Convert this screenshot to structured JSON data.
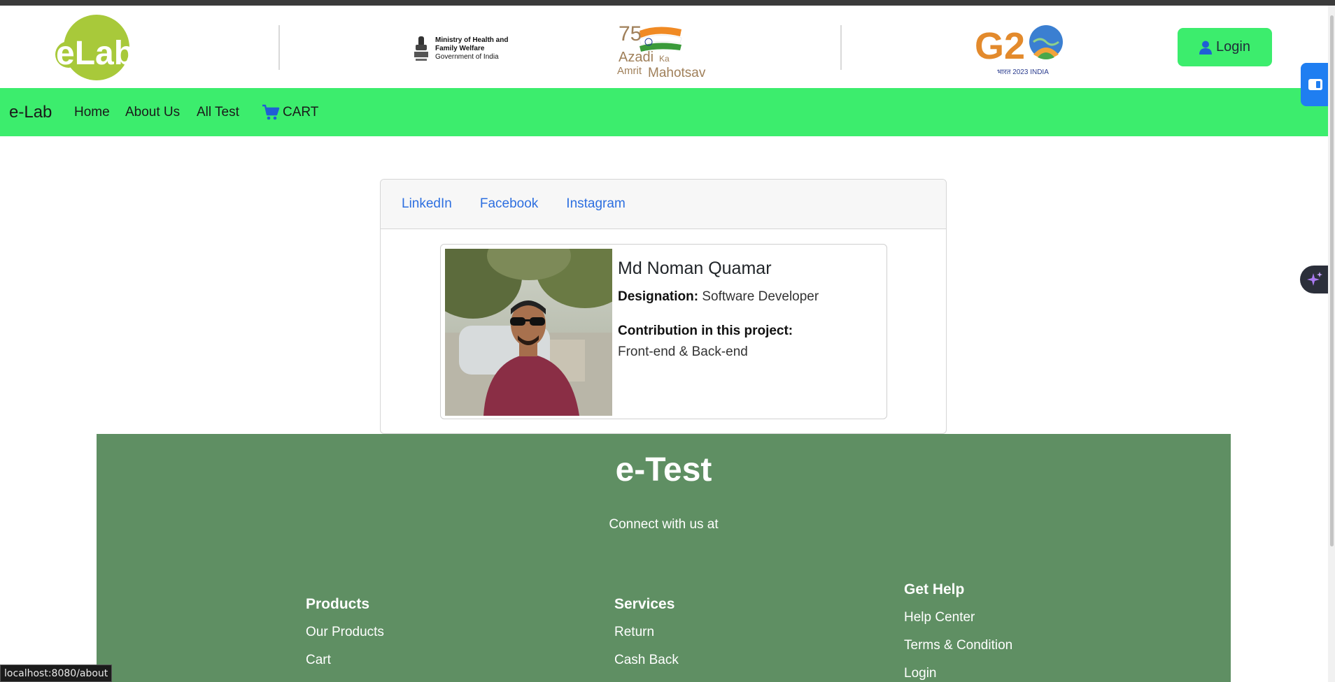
{
  "header": {
    "logo_text": "eLab",
    "ministry_line1": "Ministry of Health and",
    "ministry_line2": "Family Welfare",
    "ministry_line3": "Government of India",
    "azadi_text": "Azadi Ka Amrit Mahotsav",
    "g20_text": "G20",
    "login_label": "Login"
  },
  "navbar": {
    "brand": "e-Lab",
    "links": [
      "Home",
      "About Us",
      "All Test"
    ],
    "cart_label": "CART"
  },
  "card": {
    "tabs": [
      "LinkedIn",
      "Facebook",
      "Instagram"
    ],
    "member": {
      "name": "Md Noman Quamar",
      "designation_label": "Designation:",
      "designation_value": "Software Developer",
      "contribution_label": "Contribution in this project:",
      "contribution_value": "Front-end & Back-end"
    }
  },
  "footer": {
    "title": "e-Test",
    "subtitle": "Connect with us at",
    "columns": [
      {
        "heading": "Products",
        "items": [
          "Our Products",
          "Cart"
        ]
      },
      {
        "heading": "Services",
        "items": [
          "Return",
          "Cash Back"
        ]
      },
      {
        "heading": "Get Help",
        "items": [
          "Help Center",
          "Terms & Condition",
          "Login"
        ]
      }
    ]
  },
  "status_url": "localhost:8080/about",
  "colors": {
    "nav_green": "#3ced6d",
    "footer_green": "#5f8f63",
    "link_blue": "#2d6fe0",
    "logo_green": "#a8c93a"
  }
}
